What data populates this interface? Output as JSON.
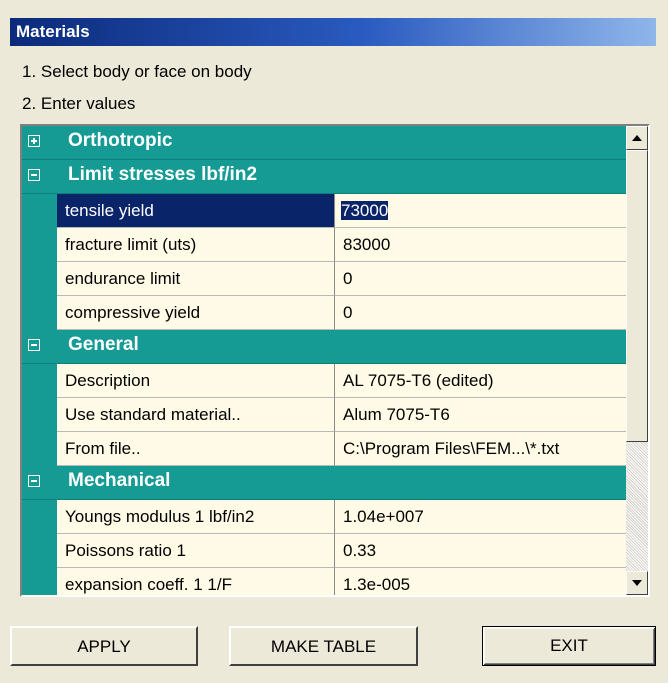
{
  "window": {
    "title": "Materials"
  },
  "instructions": [
    "1. Select body or face on body",
    "2. Enter values"
  ],
  "grid": {
    "rows": [
      {
        "kind": "category",
        "label": "Orthotropic",
        "state": "collapsed"
      },
      {
        "kind": "category",
        "label": "Limit stresses lbf/in2",
        "state": "expanded"
      },
      {
        "kind": "property",
        "name": "tensile yield",
        "value": "73000",
        "selected": true
      },
      {
        "kind": "property",
        "name": "fracture limit (uts)",
        "value": "83000"
      },
      {
        "kind": "property",
        "name": "endurance limit",
        "value": "0"
      },
      {
        "kind": "property",
        "name": "compressive yield",
        "value": "0"
      },
      {
        "kind": "category",
        "label": "General",
        "state": "expanded"
      },
      {
        "kind": "property",
        "name": "Description",
        "value": "AL 7075-T6 (edited)"
      },
      {
        "kind": "property",
        "name": "Use standard material..",
        "value": "Alum 7075-T6"
      },
      {
        "kind": "property",
        "name": "From file..",
        "value": "C:\\Program Files\\FEM...\\*.txt"
      },
      {
        "kind": "category",
        "label": "Mechanical",
        "state": "expanded"
      },
      {
        "kind": "property",
        "name": "Youngs modulus 1 lbf/in2",
        "value": "1.04e+007"
      },
      {
        "kind": "property",
        "name": "Poissons ratio 1",
        "value": "0.33"
      },
      {
        "kind": "property",
        "name": "expansion coeff. 1 1/F",
        "value": "1.3e-005"
      }
    ]
  },
  "buttons": {
    "apply": "APPLY",
    "make_table": "MAKE TABLE",
    "exit": "EXIT"
  },
  "colors": {
    "category_bg": "#159a94",
    "grid_bg": "#fffbe6",
    "selection": "#0a246a",
    "title_bar": "#0b2a7a"
  }
}
